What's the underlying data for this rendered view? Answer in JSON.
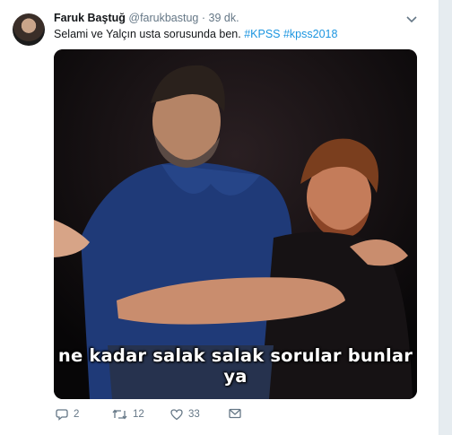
{
  "tweet": {
    "fullname": "Faruk Baştuğ",
    "username": "@farukbastug",
    "separator": "·",
    "time": "39 dk.",
    "text_plain": "Selami ve Yalçın usta sorusunda ben.",
    "hashtags": [
      "#KPSS",
      "#kpss2018"
    ],
    "media_caption": "ne kadar salak salak sorular bunlar ya",
    "actions": {
      "reply_count": "2",
      "retweet_count": "12",
      "like_count": "33"
    }
  },
  "icons": {
    "menu": "chevron-down-icon",
    "reply": "reply-icon",
    "retweet": "retweet-icon",
    "like": "heart-icon",
    "dm": "envelope-icon"
  },
  "colors": {
    "link": "#1b95e0",
    "muted": "#657786",
    "text": "#14171a"
  }
}
